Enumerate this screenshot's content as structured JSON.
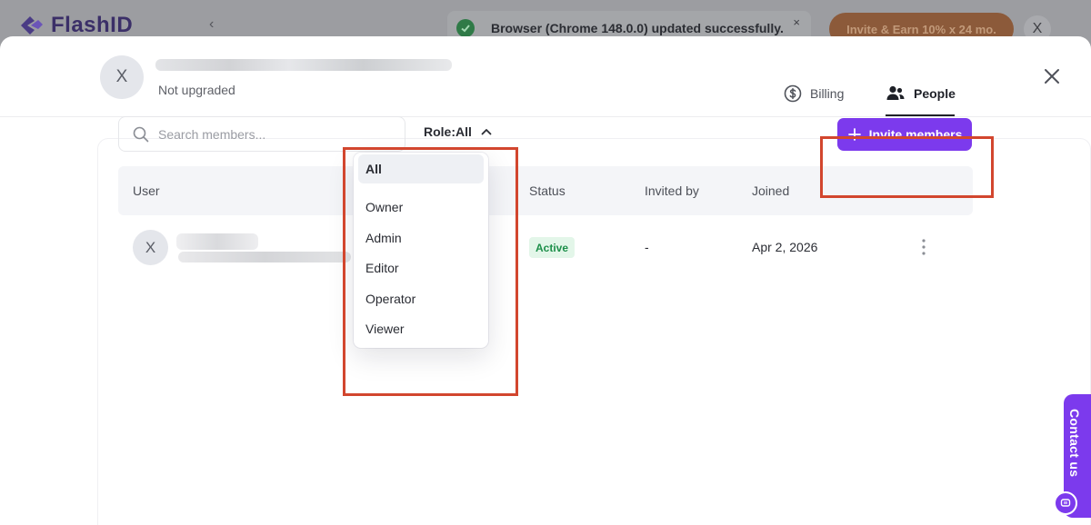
{
  "app": {
    "logo_text": "FlashID"
  },
  "notification": {
    "message": "Browser (Chrome 148.0.0) updated successfully.",
    "close_symbol": "×"
  },
  "promo": {
    "label": "Invite & Earn 10% x 24 mo."
  },
  "top_avatar": {
    "initial": "X"
  },
  "account": {
    "avatar_initial": "X",
    "plan_status": "Not upgraded"
  },
  "tabs": [
    {
      "label": "Billing",
      "icon": "dollar-circle-icon",
      "active": false
    },
    {
      "label": "People",
      "icon": "people-icon",
      "active": true
    }
  ],
  "toolbar": {
    "search_placeholder": "Search members...",
    "role_filter_label": "Role:All",
    "invite_button_label": "Invite members"
  },
  "table": {
    "columns": [
      "User",
      "Status",
      "Invited by",
      "Joined"
    ],
    "rows": [
      {
        "avatar_initial": "X",
        "status": "Active",
        "invited_by": "-",
        "joined": "Apr 2, 2026"
      }
    ]
  },
  "role_dropdown": {
    "options": [
      "All",
      "Owner",
      "Admin",
      "Editor",
      "Operator",
      "Viewer"
    ],
    "selected": "All"
  },
  "contact_tab": {
    "label": "Contact us"
  },
  "colors": {
    "accent": "#7c3aed",
    "highlight": "#d2462e",
    "status_active_bg": "#e3f6e9",
    "status_active_text": "#1d8f4a"
  }
}
